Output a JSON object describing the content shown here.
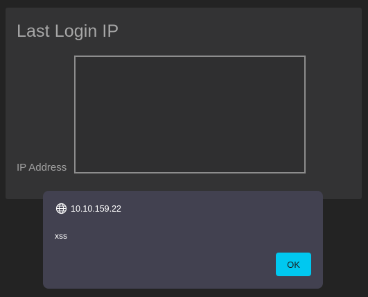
{
  "card": {
    "title": "Last Login IP",
    "field_label": "IP Address",
    "textarea_value": ""
  },
  "alert": {
    "origin": "10.10.159.22",
    "message": "xss",
    "ok_label": "OK",
    "icon": "globe-icon"
  },
  "colors": {
    "page_background": "#232323",
    "card_background": "#333334",
    "dialog_background": "#424150",
    "ok_button": "#00c8f0"
  }
}
